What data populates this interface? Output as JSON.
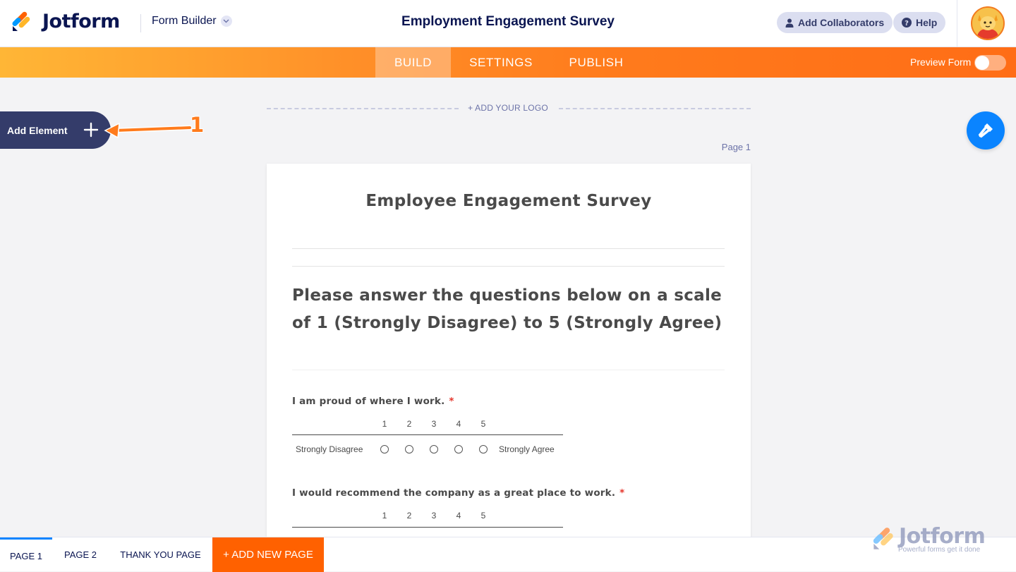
{
  "header": {
    "brand": "Jotform",
    "builder_switch": "Form Builder",
    "form_title": "Employment Engagement Survey",
    "add_collaborators": "Add Collaborators",
    "help": "Help"
  },
  "nav": {
    "tabs": [
      {
        "label": "BUILD",
        "active": true
      },
      {
        "label": "SETTINGS",
        "active": false
      },
      {
        "label": "PUBLISH",
        "active": false
      }
    ],
    "preview_label": "Preview Form",
    "preview_on": false
  },
  "left_panel": {
    "add_element": "Add Element",
    "annotation_number": "1"
  },
  "canvas_top": {
    "add_logo": "+ ADD YOUR LOGO",
    "page_label": "Page 1"
  },
  "form": {
    "heading": "Employee Engagement Survey",
    "subheading": "Please answer the questions below on a scale of 1 (Strongly Disagree) to 5 (Strongly Agree)",
    "questions": [
      {
        "label": "I am proud of where I work.",
        "required_mark": "*",
        "scale": [
          "1",
          "2",
          "3",
          "4",
          "5"
        ],
        "low_label": "Strongly Disagree",
        "high_label": "Strongly Agree"
      },
      {
        "label": "I would recommend the company as a great place to work.",
        "required_mark": "*",
        "scale": [
          "1",
          "2",
          "3",
          "4",
          "5"
        ]
      }
    ]
  },
  "bottom_bar": {
    "tabs": [
      {
        "label": "PAGE 1",
        "active": true
      },
      {
        "label": "PAGE 2",
        "active": false
      },
      {
        "label": "THANK YOU PAGE",
        "active": false
      }
    ],
    "add_page": "+ ADD NEW PAGE"
  },
  "watermark": {
    "brand": "Jotform",
    "tagline": "Powerful forms get it done"
  },
  "colors": {
    "brand_navy": "#0a1551",
    "nav_orange": "#ff7b1c",
    "add_page_orange": "#ff6100",
    "accent_blue": "#0a84ff",
    "required_red": "#e5352b"
  },
  "icons": [
    "jotform-logo-icon",
    "chevron-down-icon",
    "user-icon",
    "help-icon",
    "avatar-icon",
    "plus-icon",
    "paint-roller-icon",
    "arrow-annotation-icon"
  ]
}
